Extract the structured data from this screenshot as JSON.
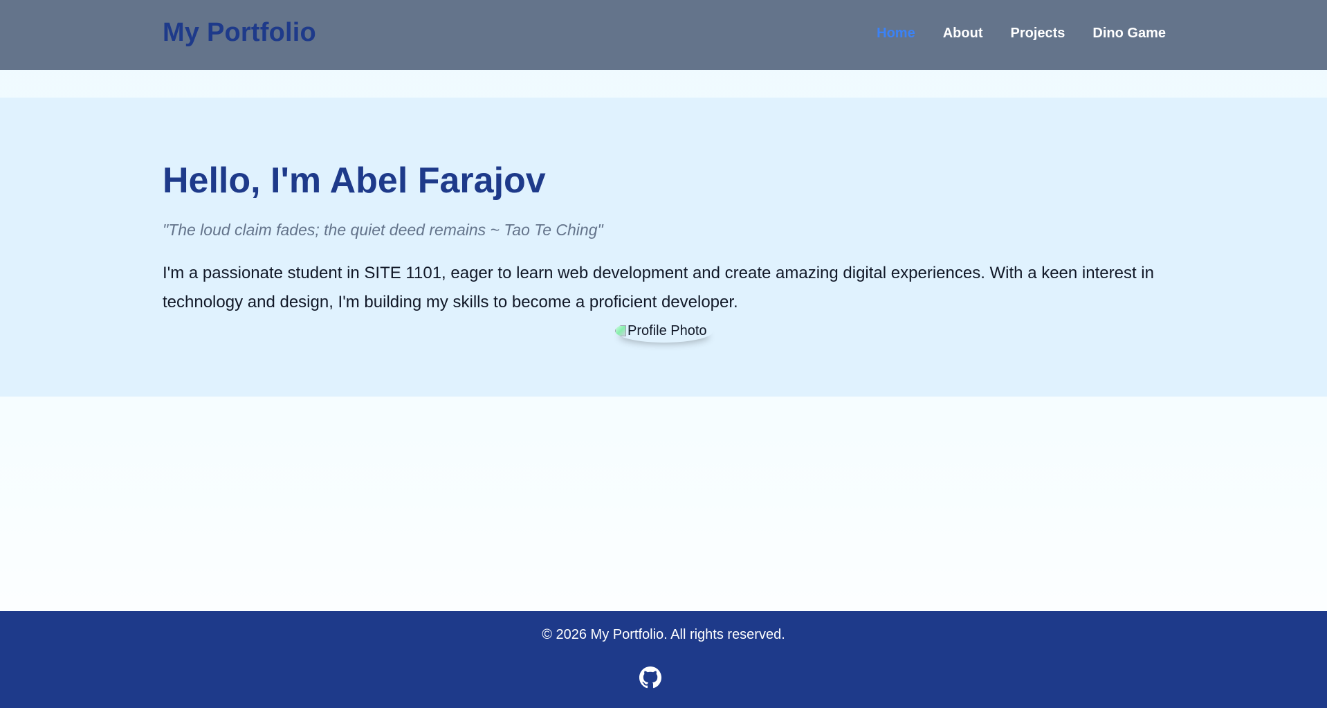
{
  "header": {
    "brand": "My Portfolio",
    "nav": [
      {
        "label": "Home",
        "active": true
      },
      {
        "label": "About",
        "active": false
      },
      {
        "label": "Projects",
        "active": false
      },
      {
        "label": "Dino Game",
        "active": false
      }
    ]
  },
  "hero": {
    "title": "Hello, I'm Abel Farajov",
    "quote": "\"The loud claim fades; the quiet deed remains ~ Tao Te Ching\"",
    "bio": "I'm a passionate student in SITE 1101, eager to learn web development and create amazing digital experiences. With a keen interest in technology and design, I'm building my skills to become a proficient developer.",
    "photo_alt": "Profile Photo"
  },
  "footer": {
    "copyright": "© 2026 My Portfolio. All rights reserved.",
    "social_icon": "github-icon"
  },
  "colors": {
    "header_bg": "#64748b",
    "brand": "#1e3a8a",
    "nav_active": "#3b82f6",
    "hero_bg": "#e0f2fe",
    "footer_bg": "#1e3a8a"
  }
}
